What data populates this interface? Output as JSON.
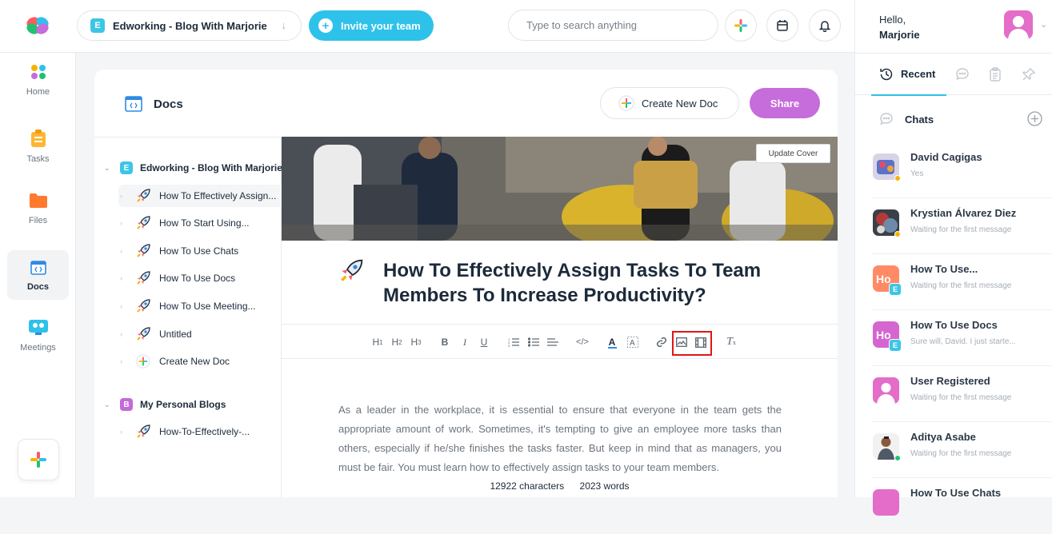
{
  "topbar": {
    "workspace_badge": "E",
    "workspace_name": "Edworking - Blog With Marjorie",
    "invite_label": "Invite your team",
    "search_placeholder": "Type to search anything"
  },
  "nav": {
    "items": [
      {
        "label": "Home",
        "icon": "home-grid-icon"
      },
      {
        "label": "Tasks",
        "icon": "clipboard-icon"
      },
      {
        "label": "Files",
        "icon": "folder-icon"
      },
      {
        "label": "Docs",
        "icon": "code-doc-icon"
      },
      {
        "label": "Meetings",
        "icon": "meeting-icon"
      }
    ],
    "active": "Docs"
  },
  "docs": {
    "title": "Docs",
    "create_label": "Create New Doc",
    "share_label": "Share",
    "tree": [
      {
        "badge": "E",
        "name": "Edworking - Blog With Marjorie",
        "items": [
          "How To Effectively Assign...",
          "How To Start Using...",
          "How To Use Chats",
          "How To Use Docs",
          "How To Use Meeting...",
          "Untitled"
        ],
        "create_label": "Create New Doc"
      },
      {
        "badge": "B",
        "name": "My Personal Blogs",
        "items": [
          "How-To-Effectively-..."
        ]
      }
    ]
  },
  "editor": {
    "update_cover": "Update Cover",
    "title": "How To Effectively Assign Tasks To Team Members To Increase Productivity?",
    "toolbar": [
      "H1",
      "H2",
      "H3",
      "B",
      "I",
      "U",
      "ordered-list",
      "bullet-list",
      "align",
      "code",
      "text-color",
      "highlight",
      "link",
      "image",
      "video",
      "clear-format"
    ],
    "body": "As a leader in the workplace, it is essential to ensure that everyone in the team gets the appropriate amount of work. Sometimes, it's tempting to give an employee more tasks than others, especially if he/she finishes the tasks faster. But keep in mind that as managers, you must be fair. You must learn how to effectively assign tasks to your team members.",
    "characters": "12922 characters",
    "words": "2023 words"
  },
  "right_panel": {
    "hello": "Hello,",
    "user": "Marjorie",
    "tab_recent": "Recent",
    "chats_label": "Chats",
    "chats": [
      {
        "name": "David Cagigas",
        "message": "Yes",
        "status": "#f5b400"
      },
      {
        "name": "Krystian Álvarez Diez",
        "message": "Waiting for the first message",
        "status": "#f5b400"
      },
      {
        "name": "How To Use...",
        "message": "Waiting for the first message",
        "badge": "E"
      },
      {
        "name": "How To Use Docs",
        "message": "Sure will, David. I just starte...",
        "badge": "E"
      },
      {
        "name": "User Registered",
        "message": "Waiting for the first message"
      },
      {
        "name": "Aditya Asabe",
        "message": "Waiting for the first message",
        "status": "#20c270"
      },
      {
        "name": "How To Use Chats",
        "message": ""
      }
    ]
  },
  "colors": {
    "accent_blue": "#2ec2ea",
    "share_purple": "#c66cdb",
    "highlight_red": "#e01616"
  }
}
